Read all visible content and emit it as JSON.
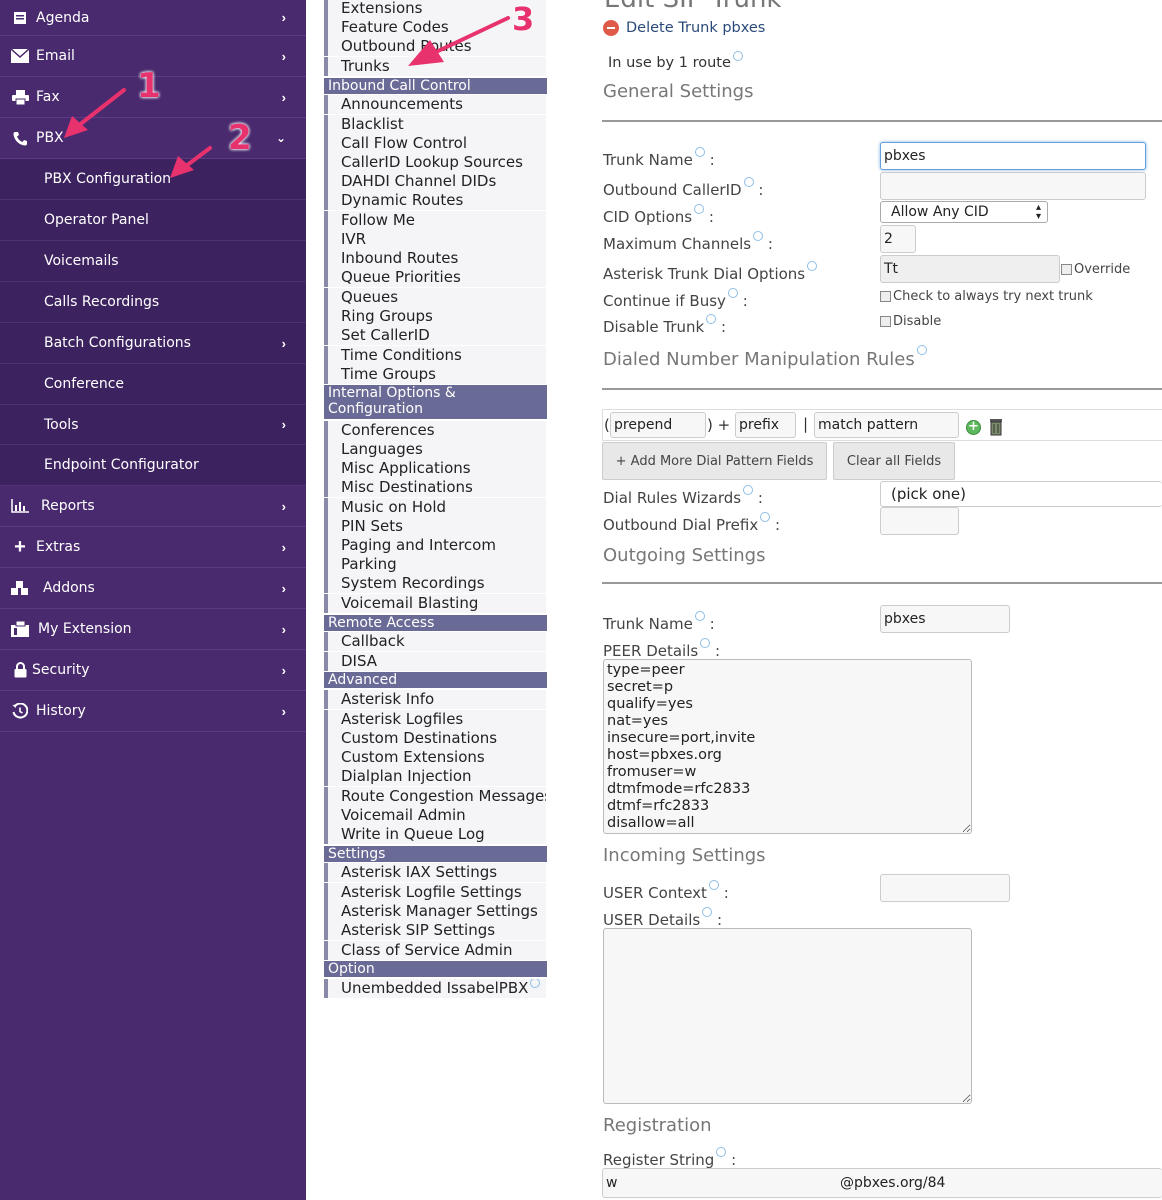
{
  "sidebar": {
    "items": [
      {
        "label": "Agenda",
        "icon": "agenda-icon"
      },
      {
        "label": "Email",
        "icon": "envelope-icon"
      },
      {
        "label": "Fax",
        "icon": "printer-icon"
      },
      {
        "label": "PBX",
        "icon": "phone-icon"
      },
      {
        "label": "Reports",
        "icon": "bar-chart-icon"
      },
      {
        "label": "Extras",
        "icon": "plus-icon"
      },
      {
        "label": "Addons",
        "icon": "cubes-icon"
      },
      {
        "label": "My Extension",
        "icon": "fax-machine-icon"
      },
      {
        "label": "Security",
        "icon": "lock-icon"
      },
      {
        "label": "History",
        "icon": "history-icon"
      }
    ],
    "pbx_sub": [
      "PBX Configuration",
      "Operator Panel",
      "Voicemails",
      "Calls Recordings",
      "Batch Configurations",
      "Conference",
      "Tools",
      "Endpoint Configurator"
    ]
  },
  "menu": {
    "top": [
      "Extensions",
      "Feature Codes",
      "Outbound Routes",
      "Trunks"
    ],
    "inbound_header": "Inbound Call Control",
    "inbound": [
      "Announcements",
      "Blacklist",
      "Call Flow Control",
      "CallerID Lookup Sources",
      "DAHDI Channel DIDs",
      "Dynamic Routes",
      "Follow Me",
      "IVR",
      "Inbound Routes",
      "Queue Priorities",
      "Queues",
      "Ring Groups",
      "Set CallerID",
      "Time Conditions",
      "Time Groups"
    ],
    "internal_header": "Internal Options & Configuration",
    "internal": [
      "Conferences",
      "Languages",
      "Misc Applications",
      "Misc Destinations",
      "Music on Hold",
      "PIN Sets",
      "Paging and Intercom",
      "Parking",
      "System Recordings",
      "Voicemail Blasting"
    ],
    "remote_header": "Remote Access",
    "remote": [
      "Callback",
      "DISA"
    ],
    "advanced_header": "Advanced",
    "advanced": [
      "Asterisk Info",
      "Asterisk Logfiles",
      "Custom Destinations",
      "Custom Extensions",
      "Dialplan Injection",
      "Route Congestion Messages",
      "Voicemail Admin",
      "Write in Queue Log"
    ],
    "settings_header": "Settings",
    "settings": [
      "Asterisk IAX Settings",
      "Asterisk Logfile Settings",
      "Asterisk Manager Settings",
      "Asterisk SIP Settings",
      "Class of Service Admin"
    ],
    "option_header": "Option",
    "option": [
      "Unembedded IssabelPBX"
    ]
  },
  "main": {
    "page_title": "Edit SIP Trunk",
    "delete_link": "Delete Trunk pbxes",
    "in_use": "In use by 1 route",
    "general_title": "General Settings",
    "trunk_name_label": "Trunk Name",
    "trunk_name_value": "pbxes",
    "outbound_cid_label": "Outbound CallerID",
    "outbound_cid_value": "",
    "cid_options_label": "CID Options",
    "cid_options_value": "Allow Any CID",
    "max_channels_label": "Maximum Channels",
    "max_channels_value": "2",
    "dial_options_label": "Asterisk Trunk Dial Options",
    "dial_options_value": "Tt",
    "override_label": "Override",
    "continue_busy_label": "Continue if Busy",
    "continue_busy_check": "Check to always try next trunk",
    "disable_trunk_label": "Disable Trunk",
    "disable_check": "Disable",
    "dialed_title": "Dialed Number Manipulation Rules",
    "prepend_ph": "prepend",
    "prefix_ph": "prefix",
    "match_ph": "match pattern",
    "add_more_btn": "+ Add More Dial Pattern Fields",
    "clear_btn": "Clear all Fields",
    "dial_wizards_label": "Dial Rules Wizards",
    "dial_wizards_value": "(pick one)",
    "outbound_prefix_label": "Outbound Dial Prefix",
    "outgoing_title": "Outgoing Settings",
    "out_trunk_name_label": "Trunk Name",
    "out_trunk_name_value": "pbxes",
    "peer_label": "PEER Details",
    "peer_details": "type=peer\nsecret=p\nqualify=yes\nnat=yes\ninsecure=port,invite\nhost=pbxes.org\nfromuser=w\ndtmfmode=rfc2833\ndtmf=rfc2833\ndisallow=all",
    "incoming_title": "Incoming Settings",
    "user_context_label": "USER Context",
    "user_details_label": "USER Details",
    "registration_title": "Registration",
    "register_label": "Register String",
    "register_value": "w                                                  @pbxes.org/84"
  },
  "annotations": {
    "one": "1",
    "two": "2",
    "three": "3"
  },
  "colors": {
    "sidebar": "#4a2a6e",
    "accent": "#e8326e",
    "menu_header": "#6a6a96"
  }
}
